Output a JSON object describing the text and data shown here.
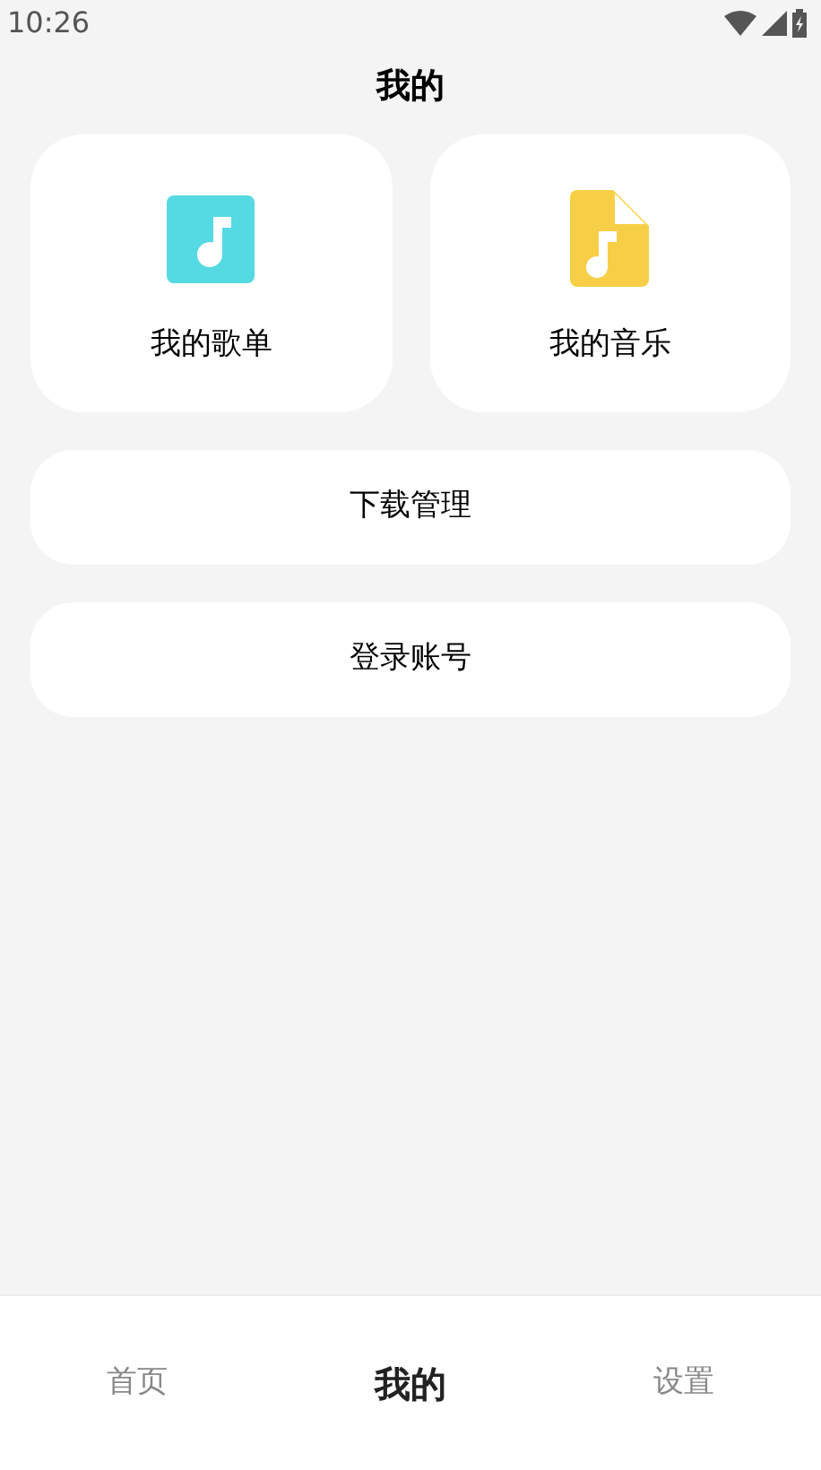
{
  "status_bar": {
    "time": "10:26"
  },
  "title": "我的",
  "tiles": [
    {
      "label": "我的歌单",
      "kind": "playlist",
      "color": "#55d9e2"
    },
    {
      "label": "我的音乐",
      "kind": "file",
      "color": "#f6cf46"
    }
  ],
  "rows": [
    {
      "label": "下载管理"
    },
    {
      "label": "登录账号"
    }
  ],
  "bottom_nav": [
    {
      "label": "首页",
      "selected": false
    },
    {
      "label": "我的",
      "selected": true
    },
    {
      "label": "设置",
      "selected": false
    }
  ]
}
